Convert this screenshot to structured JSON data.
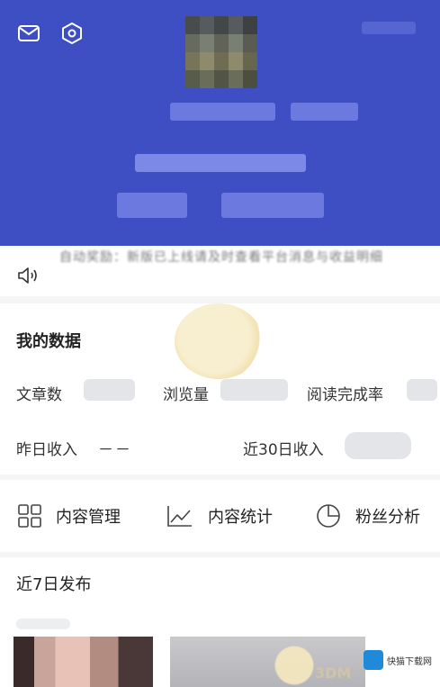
{
  "notice": {
    "text": "自动奖励：新版已上线请及时查看平台消息与收益明细"
  },
  "my_data": {
    "title": "我的数据",
    "articles_label": "文章数",
    "views_label": "浏览量",
    "read_rate_label": "阅读完成率",
    "yesterday_income_label": "昨日收入",
    "yesterday_income_value": "－－",
    "income_30d_label": "近30日收入"
  },
  "menu": {
    "content_manage": "内容管理",
    "content_stats": "内容统计",
    "fans_analysis": "粉丝分析"
  },
  "recent": {
    "title": "近7日发布"
  },
  "watermark": {
    "site_name": "快猫下载网",
    "brand": "3DM"
  },
  "colors": {
    "header_bg": "#3d4fc2",
    "page_bg": "#f4f5f7",
    "card_bg": "#ffffff"
  }
}
